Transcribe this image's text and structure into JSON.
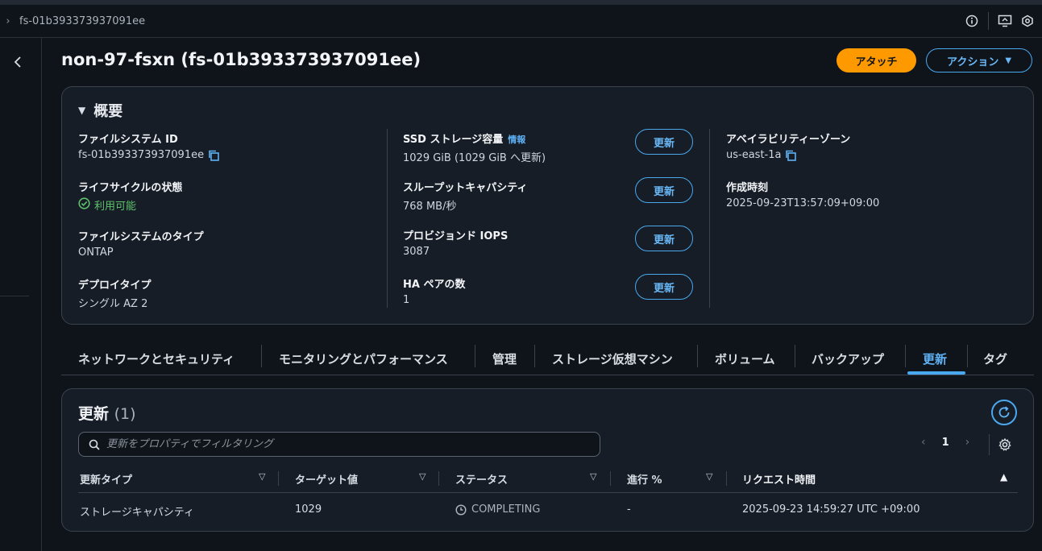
{
  "topbar": {
    "breadcrumb": "fs-01b393373937091ee",
    "icons": [
      "info-icon",
      "display-icon",
      "settings-hex-icon"
    ]
  },
  "header": {
    "title": "non-97-fsxn (fs-01b393373937091ee)",
    "attach_label": "アタッチ",
    "actions_label": "アクション"
  },
  "overview": {
    "heading": "概要",
    "col1": [
      {
        "label": "ファイルシステム ID",
        "value": "fs-01b393373937091ee"
      },
      {
        "label": "ライフサイクルの状態",
        "value": "利用可能"
      },
      {
        "label": "ファイルシステムのタイプ",
        "value": "ONTAP"
      },
      {
        "label": "デプロイタイプ",
        "value": "シングル AZ 2"
      }
    ],
    "col2": [
      {
        "label": "SSD ストレージ容量",
        "info": "情報",
        "value": "1029 GiB (1029 GiB へ更新)"
      },
      {
        "label": "スループットキャパシティ",
        "value": "768 MB/秒"
      },
      {
        "label": "プロビジョンド IOPS",
        "value": "3087"
      },
      {
        "label": "HA ペアの数",
        "value": "1"
      }
    ],
    "update_label": "更新",
    "col3": [
      {
        "label": "アベイラビリティーゾーン",
        "value": "us-east-1a"
      },
      {
        "label": "作成時刻",
        "value": "2025-09-23T13:57:09+09:00"
      }
    ]
  },
  "tabs": [
    {
      "label": "ネットワークとセキュリティ"
    },
    {
      "label": "モニタリングとパフォーマンス"
    },
    {
      "label": "管理"
    },
    {
      "label": "ストレージ仮想マシン"
    },
    {
      "label": "ボリューム"
    },
    {
      "label": "バックアップ"
    },
    {
      "label": "更新"
    },
    {
      "label": "タグ"
    }
  ],
  "updates": {
    "title": "更新",
    "count": "(1)",
    "search_placeholder": "更新をプロパティでフィルタリング",
    "page": "1",
    "columns": [
      "更新タイプ",
      "ターゲット値",
      "ステータス",
      "進行 %",
      "リクエスト時間"
    ],
    "rows": [
      {
        "type": "ストレージキャパシティ",
        "target": "1029",
        "status": "COMPLETING",
        "progress": "-",
        "requested": "2025-09-23 14:59:27 UTC +09:00"
      }
    ]
  },
  "colors": {
    "accent": "#4aa8ef",
    "primary_button": "#ff9900",
    "success": "#5ec26a"
  }
}
